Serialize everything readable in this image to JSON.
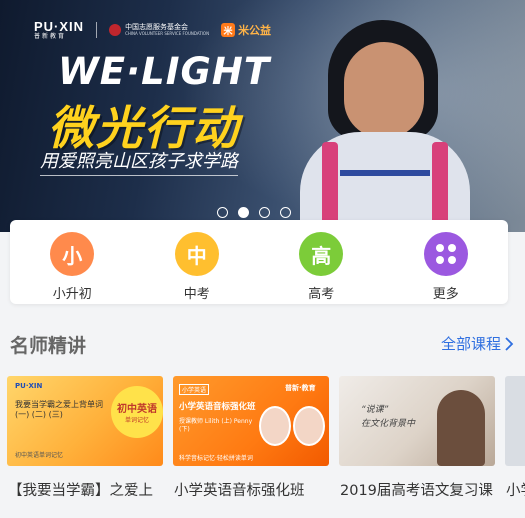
{
  "banner": {
    "logo_puxin": "PU·XIN",
    "logo_puxin_sub": "普新教育",
    "logo_fund_cn": "中国志愿服务基金会",
    "logo_fund_en": "CHINA VOLUNTEER SERVICE FOUNDATION",
    "logo_mi_mark": "米",
    "logo_mi": "米公益",
    "headline": "WE·LIGHT",
    "title": "微光行动",
    "subtitle": "用爱照亮山区孩子求学路",
    "carousel_count": 4,
    "carousel_active": 2
  },
  "categories": [
    {
      "icon_char": "小",
      "label": "小升初",
      "color": "#ff8a4c"
    },
    {
      "icon_char": "中",
      "label": "中考",
      "color": "#ffbf2f"
    },
    {
      "icon_char": "高",
      "label": "高考",
      "color": "#7ccc39"
    },
    {
      "icon_char": "",
      "label": "更多",
      "color": "#9b58e0"
    }
  ],
  "section": {
    "title": "名师精讲",
    "link": "全部课程",
    "link_icon": "chevron-right-icon"
  },
  "courses": [
    {
      "caption": "【我要当学霸】之爱上",
      "thumb": {
        "logo": "PU·XIN",
        "text": "我要当学霸之爱上背单词",
        "text2": "(一) (二) (三)",
        "badge_title": "初中英语",
        "badge_sub": "单词记忆",
        "foot": "初中英语单词记忆"
      }
    },
    {
      "caption": "小学英语音标强化班",
      "thumb": {
        "tag": "小学英语",
        "brand": "普新·教育",
        "title": "小学英语音标强化班",
        "lines": "授课教师 Lilith (上) Penny (下)",
        "foot": "科学音标记忆·轻松拼读单词"
      }
    },
    {
      "caption": "2019届高考语文复习课",
      "thumb": {
        "note": "“说课”\n在文化背景中"
      }
    },
    {
      "caption": "小学",
      "thumb": {}
    }
  ]
}
